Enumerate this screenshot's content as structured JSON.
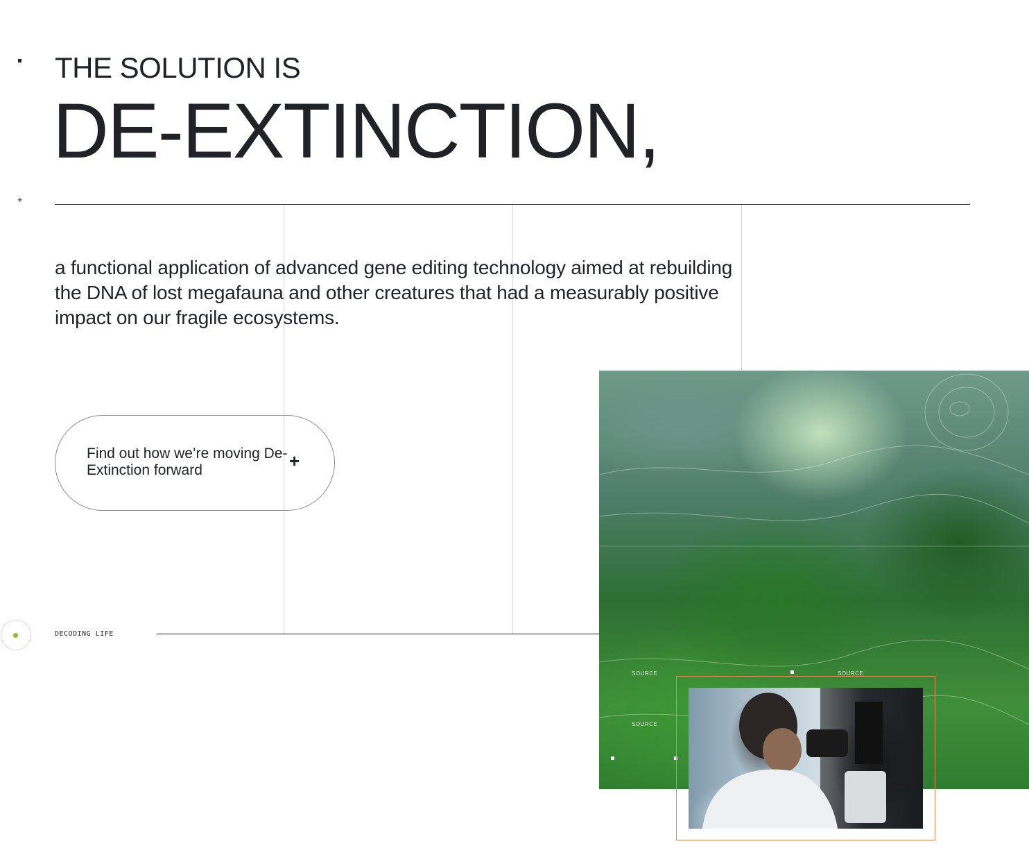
{
  "hero": {
    "eyebrow": "THE SOLUTION IS",
    "headline": "DE-EXTINCTION,",
    "description": "a functional application of advanced gene editing technology aimed at rebuilding the DNA of lost megafauna and other creatures that had a measurably positive impact on our fragile ecosystems."
  },
  "cta": {
    "label": "Find out how we’re moving De-Extinction forward",
    "icon": "plus-icon"
  },
  "section": {
    "label": "DECODING LIFE",
    "indicator_color": "#7ec928"
  },
  "media": {
    "forest_tags": [
      "SOURCE",
      "SOURCE",
      "SOURCE"
    ],
    "frame_color": "#e58a4e"
  },
  "colors": {
    "text": "#1f2226",
    "background": "#ffffff",
    "accent_green": "#7ec928"
  }
}
